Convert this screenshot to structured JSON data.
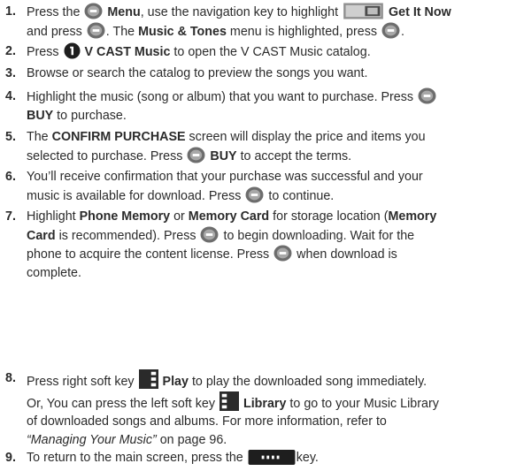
{
  "steps": [
    {
      "number": "1.",
      "line1": {
        "a": "Press the",
        "b": "Menu",
        "c": ", use the navigation key to highlight",
        "d": "Get It Now"
      },
      "line2": {
        "a": "and press",
        "b": ". The",
        "c": "Music & Tones",
        "d": "menu is highlighted, press",
        "e": "."
      }
    },
    {
      "number": "2.",
      "a": "Press",
      "b": "V CAST Music",
      "c": "to open the V CAST Music catalog."
    },
    {
      "number": "3.",
      "text": "Browse or search the catalog to preview the songs you want."
    },
    {
      "number": "4.",
      "line1": "Highlight the music (song or album) that you want to purchase. Press",
      "line2": {
        "a": "BUY",
        "b": "to purchase."
      }
    },
    {
      "number": "5.",
      "line1": {
        "a": "The",
        "b": "CONFIRM PURCHASE",
        "c": "screen will display the price and items you"
      },
      "line2": {
        "a": "selected to purchase. Press",
        "b": "BUY",
        "c": "to accept the terms."
      }
    },
    {
      "number": "6.",
      "line1": "You’ll receive confirmation that your purchase was successful and your",
      "line2": {
        "a": "music is available for download. Press",
        "b": "to continue."
      }
    },
    {
      "number": "7.",
      "line1": {
        "a": "Highlight",
        "b": "Phone Memory",
        "c": "or",
        "d": "Memory Card",
        "e": "for storage location (",
        "f": "Memory"
      },
      "line2": {
        "a": "Card",
        "b": "is recommended). Press",
        "c": "to begin downloading. Wait for the"
      },
      "line3": {
        "a": "phone to acquire the content license. Press",
        "b": "when download is"
      },
      "line4": "complete."
    },
    {
      "number": "8.",
      "line1": {
        "a": "Press right soft key",
        "b": "Play",
        "c": "to play the downloaded song immediately."
      },
      "line2": {
        "a": "Or, You can press the left soft key",
        "b": "Library",
        "c": "to go to your Music Library"
      },
      "line3": "of downloaded songs and albums. For more information, refer to",
      "line4": {
        "a": "“Managing Your Music”",
        "b": "on page 96."
      }
    },
    {
      "number": "9.",
      "a": "To return to the main screen, press the",
      "b": "key."
    }
  ]
}
